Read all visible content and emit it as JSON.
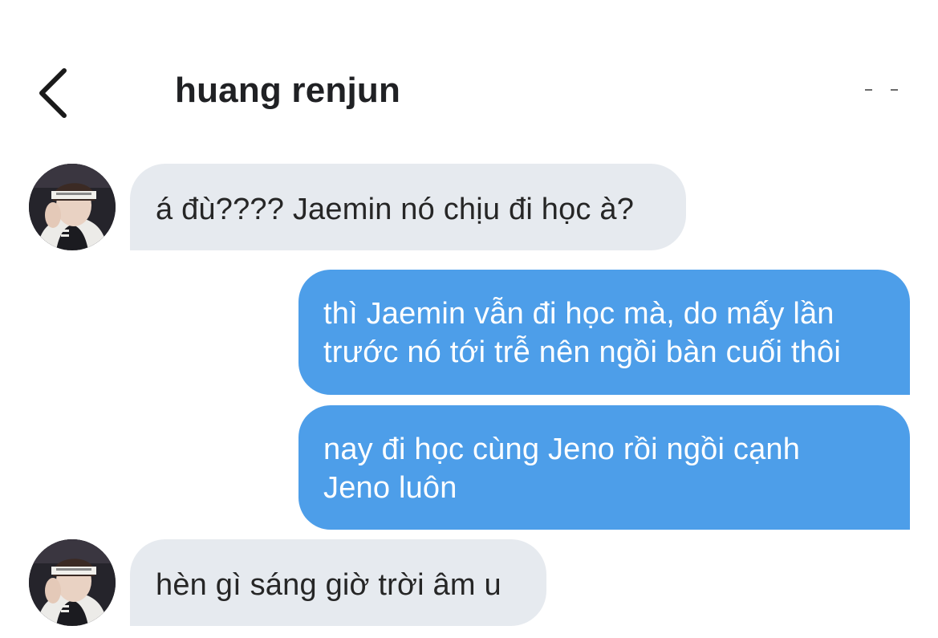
{
  "header": {
    "title": "huang renjun",
    "back_icon": "chevron-left-icon",
    "more_icon": "more-dots-icon"
  },
  "colors": {
    "incoming_bubble": "#e6eaef",
    "outgoing_bubble": "#4d9ee9",
    "outgoing_text": "#ffffff",
    "incoming_text": "#262626"
  },
  "messages": [
    {
      "direction": "incoming",
      "lines": [
        "á đù???? Jaemin nó chịu đi học à?"
      ]
    },
    {
      "direction": "outgoing",
      "lines": [
        "thì Jaemin vẫn đi học mà, do mấy lần",
        "trước nó tới trễ nên ngồi bàn cuối thôi"
      ]
    },
    {
      "direction": "outgoing",
      "lines": [
        "nay đi học cùng Jeno rồi ngồi cạnh",
        "Jeno luôn"
      ]
    },
    {
      "direction": "incoming",
      "lines": [
        "hèn gì sáng giờ trời âm u"
      ]
    }
  ]
}
